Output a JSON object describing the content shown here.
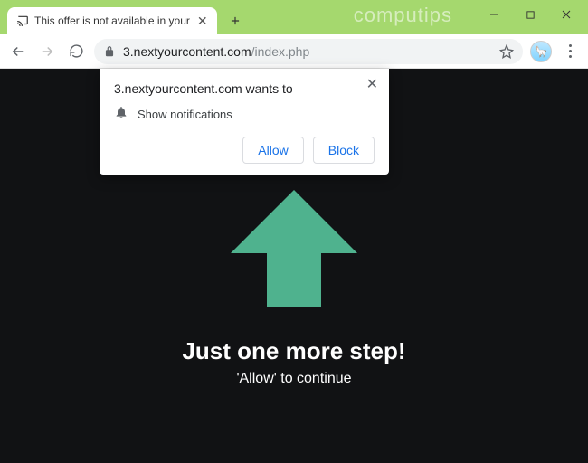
{
  "window": {
    "watermark": "computips",
    "controls": {
      "min": "minimize",
      "max": "maximize",
      "close": "close"
    }
  },
  "tab": {
    "title": "This offer is not available in your"
  },
  "toolbar": {
    "url_host": "3.nextyourcontent.com",
    "url_path": "/index.php"
  },
  "popup": {
    "title": "3.nextyourcontent.com wants to",
    "permission_text": "Show notifications",
    "allow_label": "Allow",
    "block_label": "Block"
  },
  "page": {
    "headline": "Just one more step!",
    "subline": "'Allow' to continue",
    "arrow_color": "#4fb28e"
  }
}
